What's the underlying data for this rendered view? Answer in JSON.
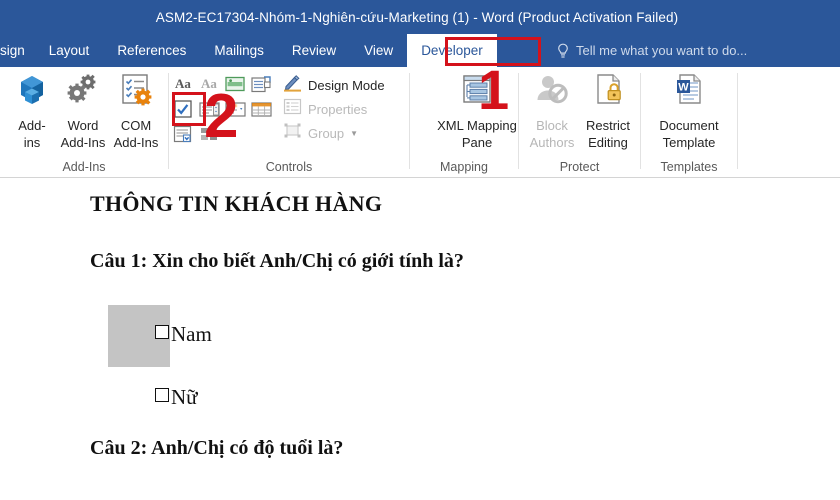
{
  "window": {
    "title": "ASM2-EC17304-Nhóm-1-Nghiên-cứu-Marketing (1) - Word (Product Activation Failed)",
    "chrome_color": "#2B579A"
  },
  "tabs": [
    {
      "label": "sign",
      "active": false,
      "partial": true
    },
    {
      "label": "Layout",
      "active": false
    },
    {
      "label": "References",
      "active": false
    },
    {
      "label": "Mailings",
      "active": false
    },
    {
      "label": "Review",
      "active": false
    },
    {
      "label": "View",
      "active": false
    },
    {
      "label": "Developer",
      "active": true
    }
  ],
  "tellme": {
    "placeholder": "Tell me what you want to do...",
    "icon": "lightbulb-icon"
  },
  "ribbon": {
    "groups": [
      {
        "name": "Add-Ins",
        "label": "Add-Ins",
        "buttons": [
          {
            "label_line1": "Add-",
            "label_line2": "ins",
            "icon": "addins-cube-icon",
            "enabled": true
          },
          {
            "label_line1": "Word",
            "label_line2": "Add-Ins",
            "icon": "word-addins-gears-icon",
            "enabled": true
          },
          {
            "label_line1": "COM",
            "label_line2": "Add-Ins",
            "icon": "com-addins-list-gear-icon",
            "enabled": true
          }
        ]
      },
      {
        "name": "Controls",
        "label": "Controls",
        "grid_icons": [
          {
            "name": "rich-text-content-control-icon",
            "glyph": "Aa",
            "enabled": true
          },
          {
            "name": "plain-text-content-control-icon",
            "glyph": "Aa",
            "enabled": false
          },
          {
            "name": "picture-content-control-icon",
            "glyph": "",
            "enabled": true
          },
          {
            "name": "building-block-gallery-content-control-icon",
            "glyph": "",
            "enabled": true
          },
          {
            "name": "check-box-content-control-icon",
            "glyph": "",
            "enabled": true
          },
          {
            "name": "combo-box-content-control-icon",
            "glyph": "",
            "enabled": true
          },
          {
            "name": "drop-down-list-content-control-icon",
            "glyph": "",
            "enabled": true
          },
          {
            "name": "date-picker-content-control-icon",
            "glyph": "",
            "enabled": true
          },
          {
            "name": "repeating-section-content-control-icon",
            "glyph": "",
            "enabled": true
          },
          {
            "name": "legacy-tools-icon",
            "glyph": "",
            "enabled": true
          }
        ],
        "commands": [
          {
            "label": "Design Mode",
            "icon": "design-mode-icon",
            "enabled": true,
            "caret": false
          },
          {
            "label": "Properties",
            "icon": "properties-icon",
            "enabled": false,
            "caret": false
          },
          {
            "label": "Group",
            "icon": "group-icon",
            "enabled": false,
            "caret": true
          }
        ]
      },
      {
        "name": "Mapping",
        "label": "Mapping",
        "buttons": [
          {
            "label_line1": "XML Mapping",
            "label_line2": "Pane",
            "icon": "xml-mapping-pane-icon",
            "enabled": true
          }
        ]
      },
      {
        "name": "Protect",
        "label": "Protect",
        "buttons": [
          {
            "label_line1": "Block",
            "label_line2": "Authors",
            "icon": "block-authors-icon",
            "enabled": false,
            "caret": true
          },
          {
            "label_line1": "Restrict",
            "label_line2": "Editing",
            "icon": "restrict-editing-lock-icon",
            "enabled": true
          }
        ]
      },
      {
        "name": "Templates",
        "label": "Templates",
        "buttons": [
          {
            "label_line1": "Document",
            "label_line2": "Template",
            "icon": "document-template-word-icon",
            "enabled": true
          }
        ]
      }
    ]
  },
  "document": {
    "heading": "THÔNG TIN KHÁCH HÀNG",
    "question1": "Câu 1: Xin cho biết Anh/Chị có giới tính là?",
    "option1": "Nam",
    "option2": "Nữ",
    "question2": "Câu 2: Anh/Chị có độ tuổi là?",
    "selection_highlight": true
  },
  "annotations": {
    "accent_color": "#D4121B",
    "marker1": "1",
    "marker2": "2"
  }
}
